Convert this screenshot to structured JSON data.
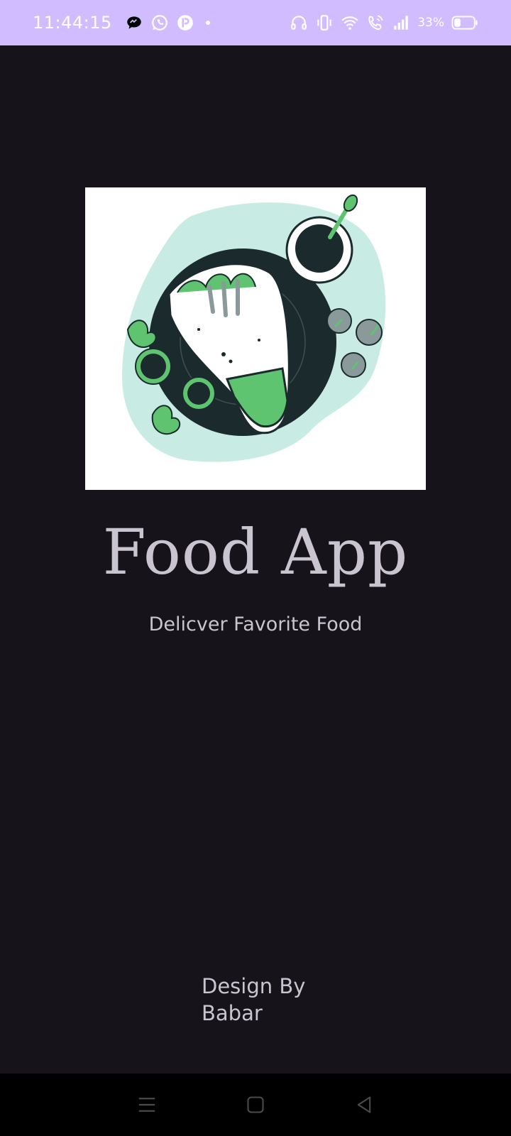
{
  "status_bar": {
    "time": "11:44:15",
    "battery_percent": "33%",
    "battery_level": 0.33,
    "left_icons": [
      "messenger-icon",
      "whatsapp-icon",
      "app-icon",
      "dot-icon"
    ],
    "right_icons": [
      "headphones-icon",
      "vibrate-icon",
      "wifi-icon",
      "wifi-call-icon",
      "signal-icon",
      "battery-icon"
    ],
    "background_color": "#d0bcff"
  },
  "app": {
    "title": "Food App",
    "subtitle": "Delicver Favorite Food",
    "credit_line1": "Design By",
    "credit_line2": "Babar",
    "text_color": "#cac4d0",
    "background_color": "#16141a"
  },
  "illustration": {
    "name": "food-plate-illustration",
    "accent_color": "#5fc46f",
    "dark_color": "#1b2a2d",
    "light_color": "#c8ece4"
  },
  "nav_bar": {
    "buttons": [
      "menu-icon",
      "home-icon",
      "back-icon"
    ]
  }
}
